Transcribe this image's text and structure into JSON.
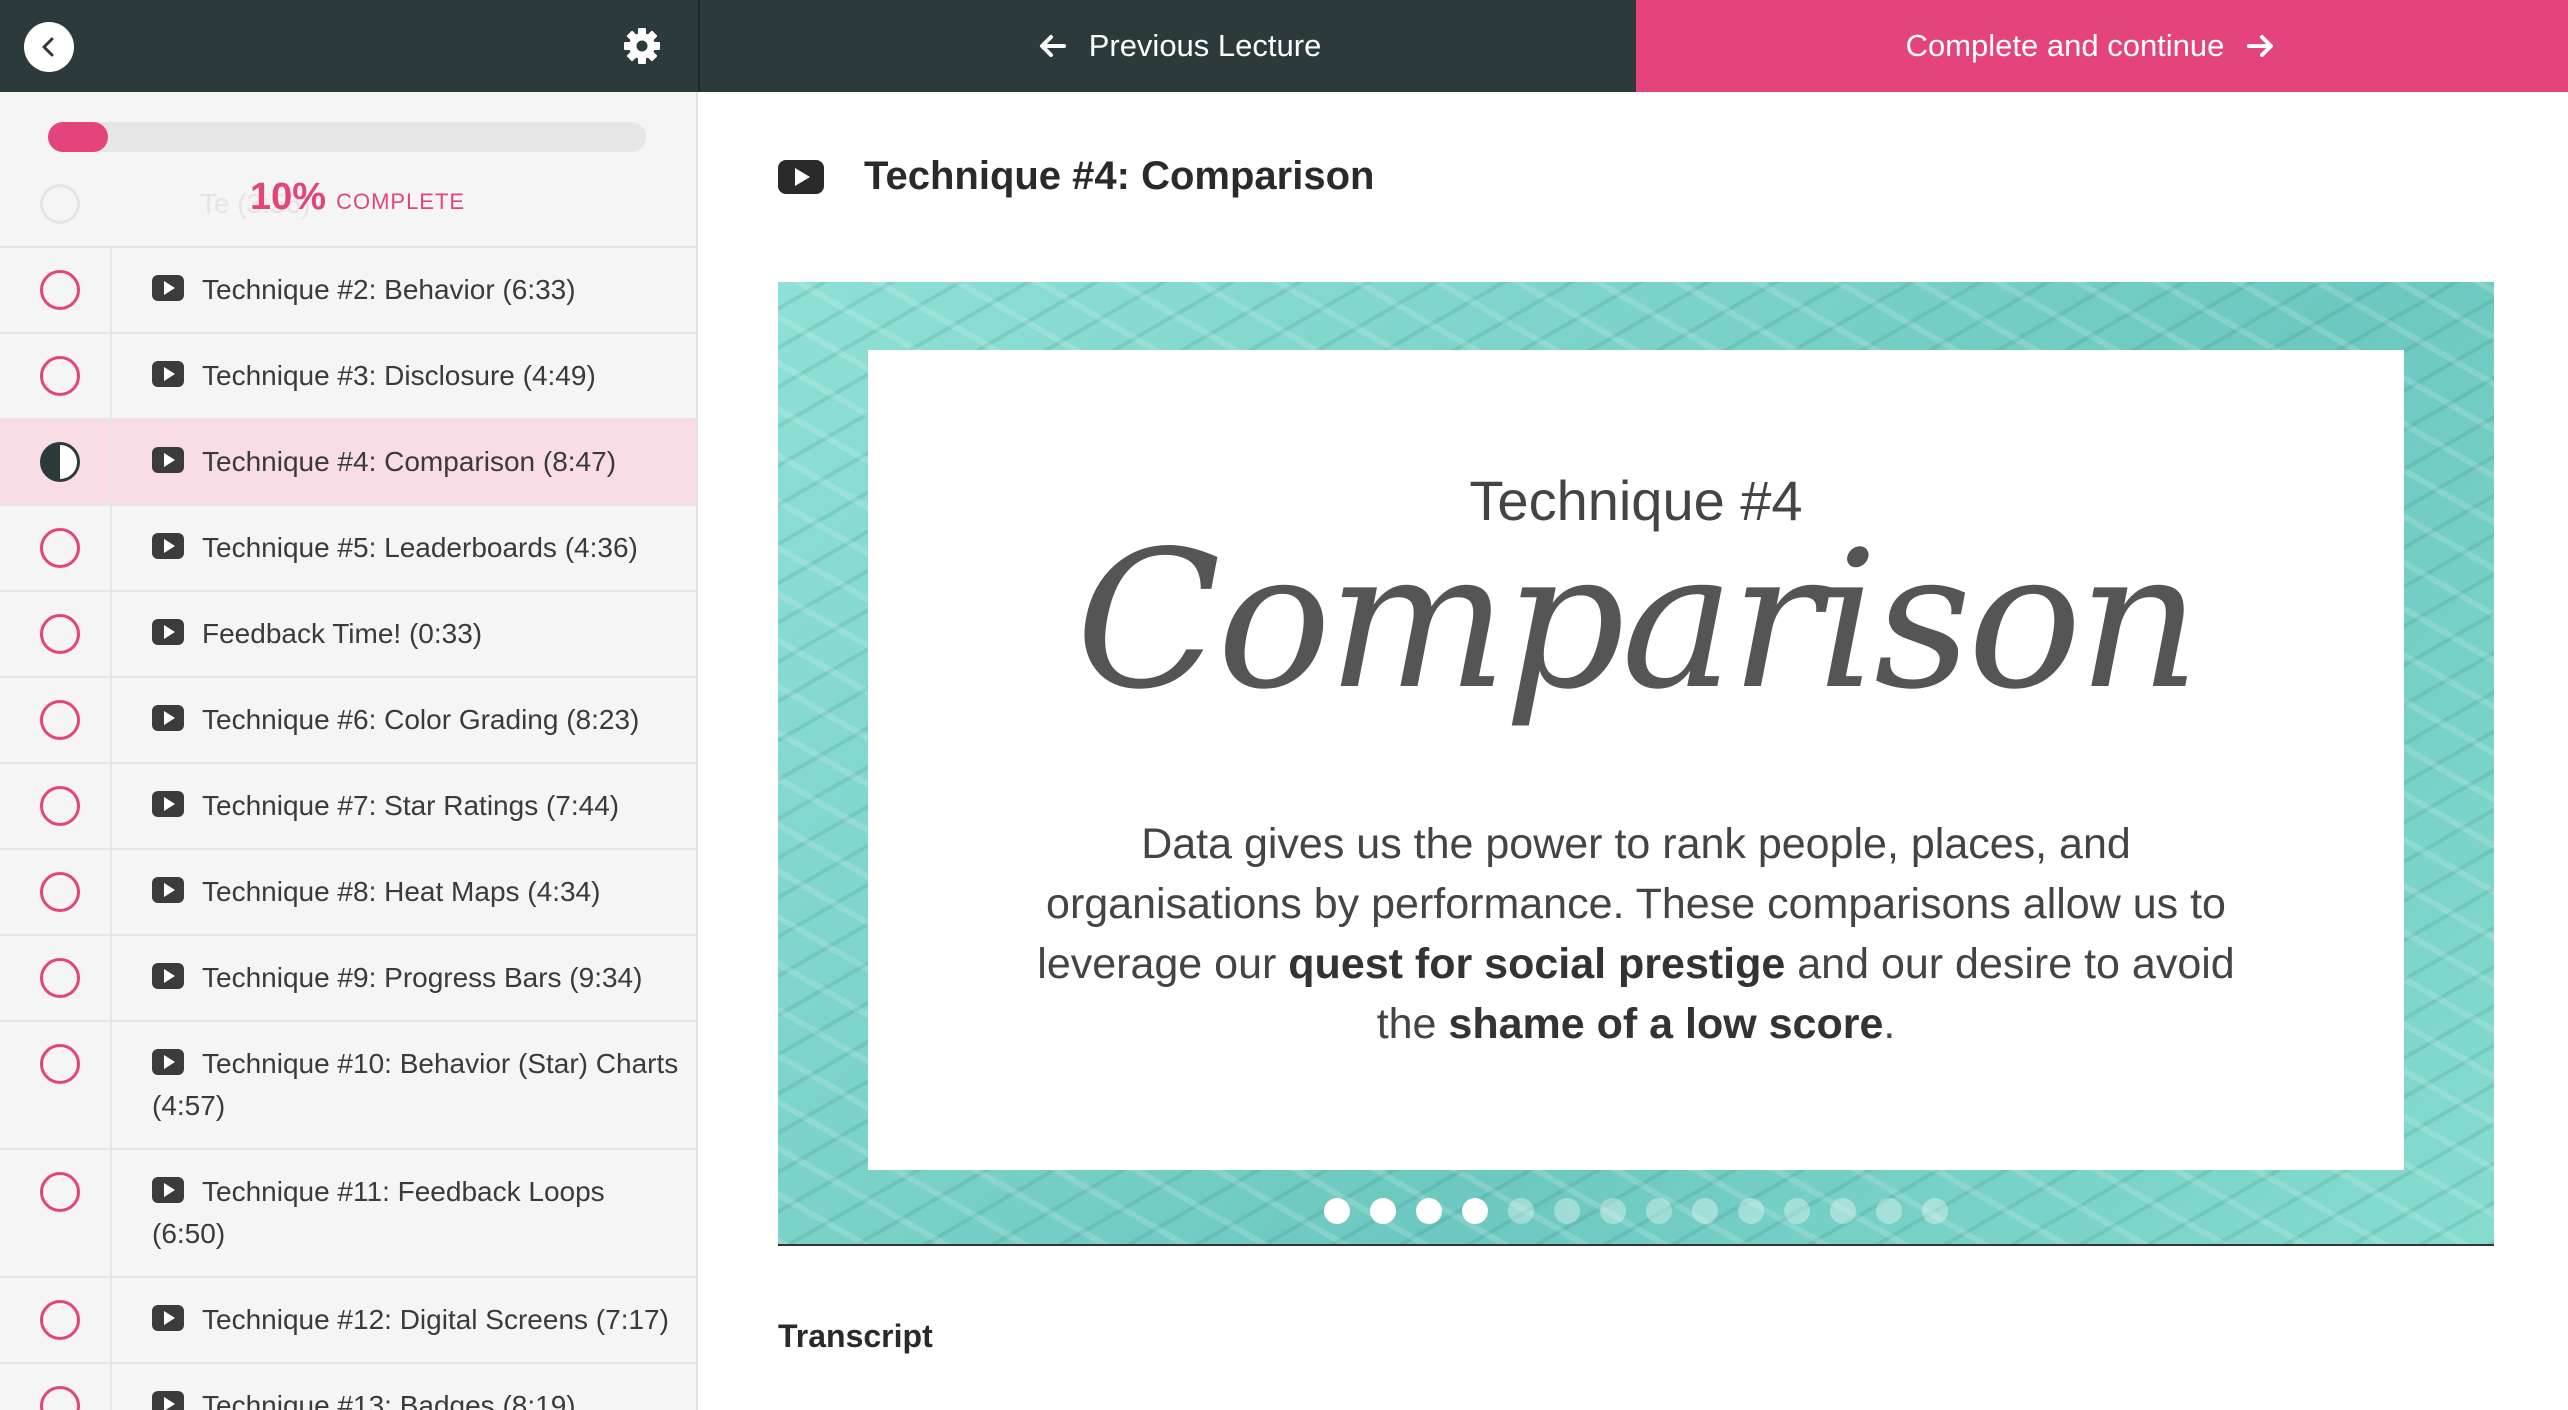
{
  "topbar": {
    "prev_label": "Previous Lecture",
    "next_label": "Complete and continue",
    "accent": "#e5437c",
    "dark": "#2d3a3c"
  },
  "progress": {
    "percent": 10,
    "percent_label": "10%",
    "complete_label": "COMPLETE",
    "ghost_text": "Te                            (3:56)"
  },
  "lessons": [
    {
      "title": "Technique #2: Behavior (6:33)",
      "state": "incomplete"
    },
    {
      "title": "Technique #3: Disclosure (4:49)",
      "state": "incomplete"
    },
    {
      "title": "Technique #4: Comparison (8:47)",
      "state": "current"
    },
    {
      "title": "Technique #5: Leaderboards (4:36)",
      "state": "incomplete"
    },
    {
      "title": "Feedback Time! (0:33)",
      "state": "incomplete"
    },
    {
      "title": "Technique #6: Color Grading (8:23)",
      "state": "incomplete"
    },
    {
      "title": "Technique #7: Star Ratings (7:44)",
      "state": "incomplete"
    },
    {
      "title": "Technique #8: Heat Maps (4:34)",
      "state": "incomplete"
    },
    {
      "title": "Technique #9: Progress Bars (9:34)",
      "state": "incomplete"
    },
    {
      "title": "Technique #10: Behavior (Star) Charts (4:57)",
      "state": "incomplete"
    },
    {
      "title": "Technique #11: Feedback Loops (6:50)",
      "state": "incomplete"
    },
    {
      "title": "Technique #12: Digital Screens (7:17)",
      "state": "incomplete"
    },
    {
      "title": "Technique #13: Badges (8:19)",
      "state": "incomplete"
    }
  ],
  "lecture": {
    "title": "Technique #4: Comparison",
    "slide": {
      "subtitle": "Technique #4",
      "script_title": "Comparison",
      "body_1": "Data gives us the power to rank people, places, and organisations by performance. These comparisons allow us to leverage our ",
      "bold_1": "quest for social prestige",
      "body_2": " and our desire to avoid the ",
      "bold_2": "shame of a low score",
      "body_3": "."
    },
    "slide_dots": {
      "total": 14,
      "active": 4
    },
    "transcript_label": "Transcript"
  }
}
